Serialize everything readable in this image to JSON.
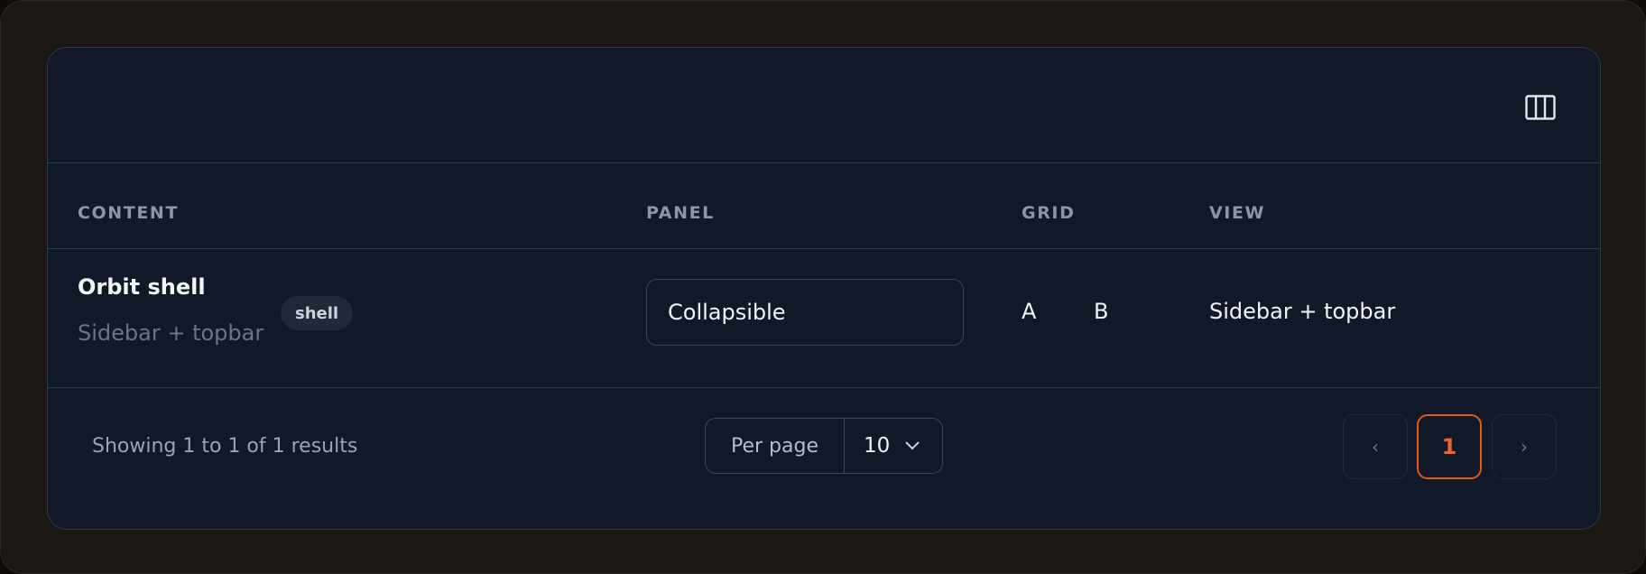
{
  "colors": {
    "accent": "#ea580c",
    "card_bg": "#111827",
    "border": "#2c3a4b"
  },
  "toolbar": {
    "columns_icon": "columns-icon"
  },
  "table": {
    "headers": {
      "content": "CONTENT",
      "panel": "PANEL",
      "grid": "GRID",
      "view": "VIEW"
    },
    "rows": [
      {
        "title": "Orbit shell",
        "subtitle": "Sidebar + topbar",
        "badge": "shell",
        "panel": "Collapsible",
        "grid_a": "A",
        "grid_b": "B",
        "view": "Sidebar + topbar"
      }
    ]
  },
  "footer": {
    "summary": "Showing 1 to 1 of 1 results",
    "per_page_label": "Per page",
    "per_page_value": "10",
    "prev": "‹",
    "current_page": "1",
    "next": "›"
  }
}
